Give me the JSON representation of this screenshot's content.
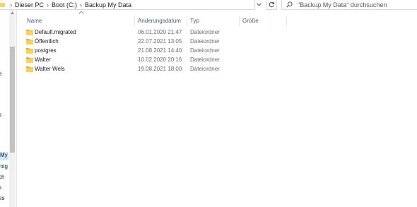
{
  "breadcrumb": {
    "items": [
      "Dieser PC",
      "Boot (C:)",
      "Backup My Data"
    ],
    "separator": "›"
  },
  "search": {
    "placeholder": "\"Backup My Data\" durchsuchen"
  },
  "nav": {
    "items": [
      "e",
      "s",
      "My D",
      "mig",
      "ch",
      "s",
      "es"
    ],
    "selected_index": 2
  },
  "columns": {
    "name": "Name",
    "date": "Änderungsdatum",
    "type": "Typ",
    "size": "Größe"
  },
  "files": [
    {
      "name": "Default.migrated",
      "date": "06.01.2020 21:47",
      "type": "Dateiordner",
      "size": ""
    },
    {
      "name": "Öffentlich",
      "date": "22.07.2021 13:05",
      "type": "Dateiordner",
      "size": ""
    },
    {
      "name": "postgres",
      "date": "21.08.2021 14:40",
      "type": "Dateiordner",
      "size": ""
    },
    {
      "name": "Walter",
      "date": "10.02.2020 20:16",
      "type": "Dateiordner",
      "size": ""
    },
    {
      "name": "Walter Wels",
      "date": "19.08.2021 18:00",
      "type": "Dateiordner",
      "size": ""
    }
  ],
  "colors": {
    "folder": "#ffd05c",
    "folder_dark": "#e8b23a",
    "selection": "#cce8ff",
    "header_text": "#4c607a"
  },
  "icons": {
    "folder": "folder-icon",
    "search": "search-icon",
    "refresh": "refresh-icon",
    "chevron": "chevron-down-icon"
  }
}
